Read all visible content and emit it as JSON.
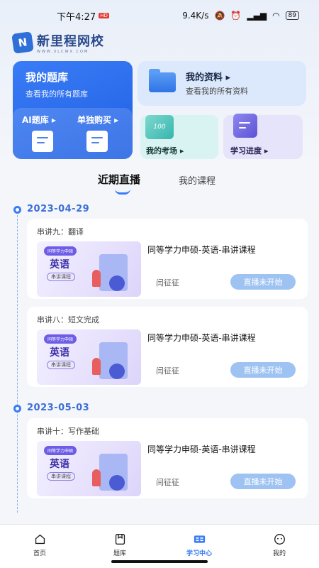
{
  "status_bar": {
    "time": "下午4:27",
    "speed": "9.4K/s",
    "battery": "89"
  },
  "brand": {
    "name": "新里程网校",
    "url": "WWW.XLCWX.COM"
  },
  "quick_cards": {
    "question_bank": {
      "title": "我的题库",
      "subtitle": "查看我的所有题库",
      "ai_bank": "AI题库 ▸",
      "single_buy": "单独购买 ▸"
    },
    "materials": {
      "title": "我的资料 ▸",
      "subtitle": "查看我的所有资料"
    },
    "exam": {
      "title": "我的考场 ▸",
      "icon_text": "100"
    },
    "progress": {
      "title": "学习进度 ▸"
    }
  },
  "tabs": [
    {
      "label": "近期直播"
    },
    {
      "label": "我的课程"
    }
  ],
  "schedule": [
    {
      "date": "2023-04-29",
      "courses": [
        {
          "lesson": "串讲九：翻译",
          "title": "同等学力申硕-英语-串讲课程",
          "teacher": "闫征征",
          "status": "直播未开始",
          "thumb_tag": "同等学力申硕",
          "thumb_subject": "英语",
          "thumb_type": "串讲课程"
        },
        {
          "lesson": "串讲八：短文完成",
          "title": "同等学力申硕-英语-串讲课程",
          "teacher": "闫征征",
          "status": "直播未开始",
          "thumb_tag": "同等学力申硕",
          "thumb_subject": "英语",
          "thumb_type": "串讲课程"
        }
      ]
    },
    {
      "date": "2023-05-03",
      "courses": [
        {
          "lesson": "串讲十：写作基础",
          "title": "同等学力申硕-英语-串讲课程",
          "teacher": "闫征征",
          "status": "直播未开始",
          "thumb_tag": "同等学力申硕",
          "thumb_subject": "英语",
          "thumb_type": "串讲课程"
        }
      ]
    }
  ],
  "bottom_nav": [
    {
      "label": "首页",
      "icon": "home-icon"
    },
    {
      "label": "题库",
      "icon": "question-bank-icon"
    },
    {
      "label": "学习中心",
      "icon": "study-center-icon",
      "active": true
    },
    {
      "label": "我的",
      "icon": "profile-icon"
    }
  ],
  "colors": {
    "primary": "#3a7cf6",
    "live_button": "#9ec3f2",
    "timeline": "#3a6fd8"
  }
}
